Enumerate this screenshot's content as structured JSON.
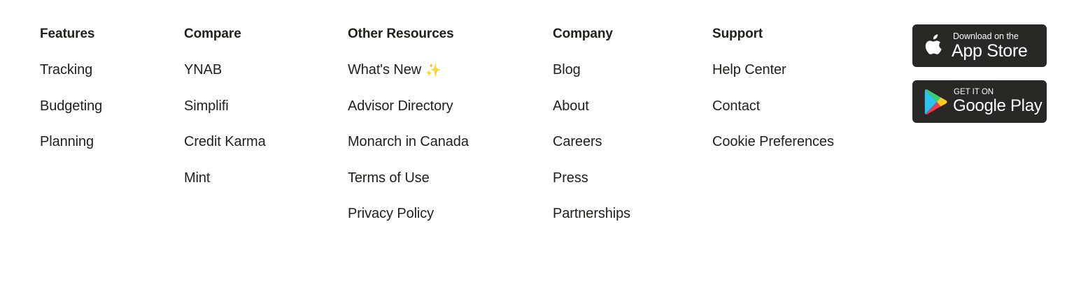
{
  "columns": [
    {
      "heading": "Features",
      "links": [
        "Tracking",
        "Budgeting",
        "Planning"
      ]
    },
    {
      "heading": "Compare",
      "links": [
        "YNAB",
        "Simplifi",
        "Credit Karma",
        "Mint"
      ]
    },
    {
      "heading": "Other Resources",
      "links": [
        "What's New",
        "Advisor Directory",
        "Monarch in Canada",
        "Terms of Use",
        "Privacy Policy"
      ],
      "whats_new_emoji": "✨"
    },
    {
      "heading": "Company",
      "links": [
        "Blog",
        "About",
        "Careers",
        "Press",
        "Partnerships"
      ]
    },
    {
      "heading": "Support",
      "links": [
        "Help Center",
        "Contact",
        "Cookie Preferences"
      ]
    }
  ],
  "badges": {
    "app_store": {
      "small": "Download on the",
      "big": "App Store",
      "icon": "apple-icon"
    },
    "google_play": {
      "small": "GET IT ON",
      "big": "Google Play",
      "icon": "google-play-icon"
    }
  },
  "colors": {
    "text": "#22201d",
    "badge_bg": "#2a2825",
    "sparkle": "#f0b93a"
  }
}
